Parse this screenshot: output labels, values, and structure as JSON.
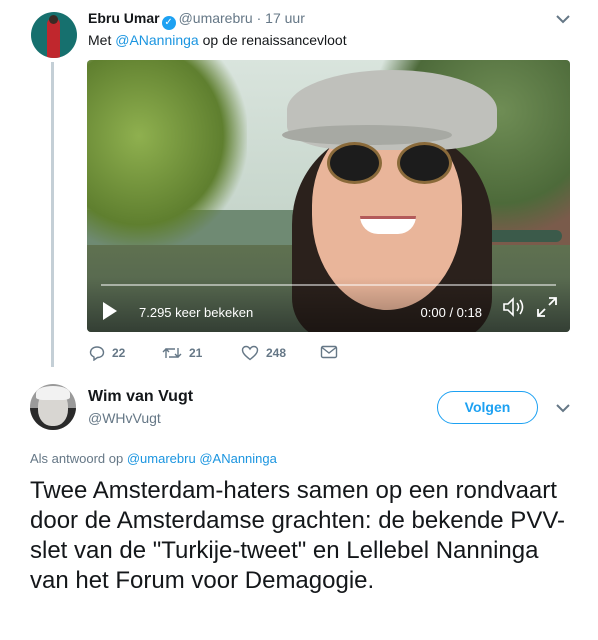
{
  "tweet1": {
    "author_name": "Ebru Umar",
    "handle": "@umarebru",
    "separator": "·",
    "time": "17 uur",
    "text_prefix": "Met",
    "text_mention": "@ANanninga",
    "text_suffix": "op de renaissancevloot",
    "video": {
      "views": "7.295 keer bekeken",
      "time": "0:00 / 0:18",
      "progress": 0
    },
    "actions": {
      "replies": "22",
      "retweets": "21",
      "likes": "248"
    }
  },
  "tweet2": {
    "author_name": "Wim van Vugt",
    "handle": "@WHvVugt",
    "follow_label": "Volgen",
    "reply_prefix": "Als antwoord op",
    "reply_mention1": "@umarebru",
    "reply_mention2": "@ANanninga",
    "text": "Twee Amsterdam-haters samen op een rondvaart door de Amsterdamse grachten: de bekende PVV-slet van de \"Turkije-tweet\" en Lellebel Nanninga van het Forum voor Demagogie."
  },
  "icons": [
    "verified-icon",
    "chevron-down-icon",
    "play-icon",
    "volume-icon",
    "fullscreen-icon",
    "reply-icon",
    "retweet-icon",
    "like-icon",
    "direct-message-icon"
  ],
  "colors": {
    "accent": "#1da1f2",
    "mention": "#1b95e0",
    "muted": "#657786",
    "thread_line": "#c4cfd6"
  }
}
